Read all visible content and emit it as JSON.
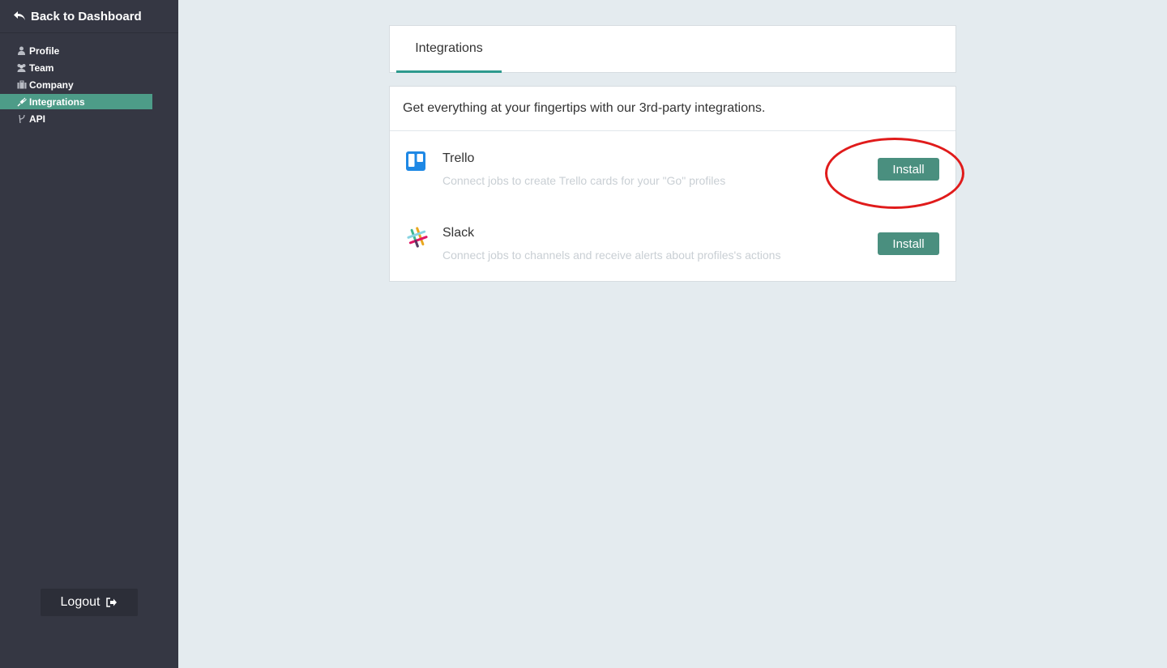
{
  "sidebar": {
    "back_label": "Back to Dashboard",
    "items": [
      {
        "label": "Profile",
        "icon": "user-icon"
      },
      {
        "label": "Team",
        "icon": "users-icon"
      },
      {
        "label": "Company",
        "icon": "briefcase-icon"
      },
      {
        "label": "Integrations",
        "icon": "plug-icon",
        "active": true
      },
      {
        "label": "API",
        "icon": "api-icon"
      }
    ],
    "logout_label": "Logout"
  },
  "main": {
    "tabs": [
      {
        "label": "Integrations",
        "active": true
      }
    ],
    "intro": "Get everything at your fingertips with our 3rd-party integrations.",
    "integrations": [
      {
        "name": "Trello",
        "description": "Connect jobs to create Trello cards for your \"Go\" profiles",
        "button": "Install",
        "icon": "trello-icon"
      },
      {
        "name": "Slack",
        "description": "Connect jobs to channels and receive alerts about profiles's actions",
        "button": "Install",
        "icon": "slack-icon"
      }
    ]
  },
  "colors": {
    "sidebar_bg": "#353743",
    "accent": "#4d9c88",
    "button": "#4a8f7f",
    "tab_underline": "#2d9a8e",
    "highlight": "#e01b1b"
  }
}
